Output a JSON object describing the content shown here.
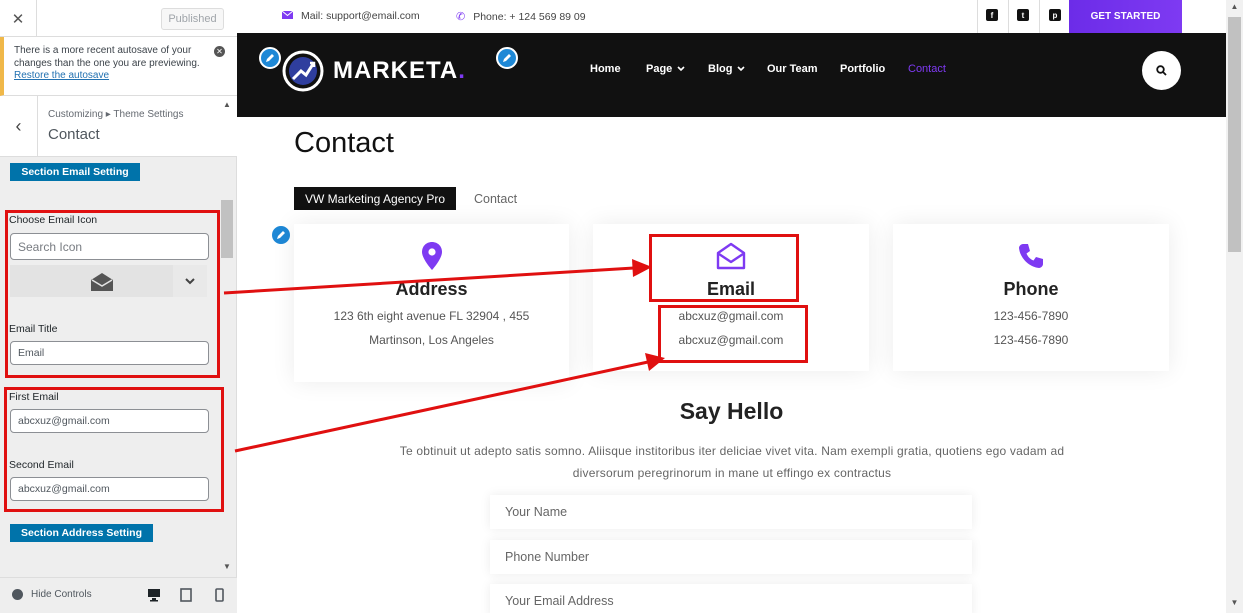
{
  "sidebar": {
    "published_label": "Published",
    "notice": {
      "text": "There is a more recent autosave of your changes than the one you are previewing.",
      "link": "Restore the autosave"
    },
    "breadcrumb": "Customizing ▸ Theme Settings",
    "title": "Contact",
    "section_email_label": "Section Email Setting",
    "choose_icon_label": "Choose Email Icon",
    "search_icon_placeholder": "Search Icon",
    "email_title_label": "Email Title",
    "email_title_value": "Email",
    "first_email_label": "First Email",
    "first_email_value": "abcxuz@gmail.com",
    "second_email_label": "Second Email",
    "second_email_value": "abcxuz@gmail.com",
    "section_address_label": "Section Address Setting",
    "hide_controls_label": "Hide Controls"
  },
  "preview": {
    "topbar": {
      "mail": "Mail: support@email.com",
      "phone": "Phone: + 124 569 89 09",
      "cta": "GET STARTED"
    },
    "logo": "MARKETA",
    "nav": [
      {
        "label": "Home"
      },
      {
        "label": "Page"
      },
      {
        "label": "Blog"
      },
      {
        "label": "Our Team"
      },
      {
        "label": "Portfolio"
      },
      {
        "label": "Contact"
      }
    ],
    "page_title": "Contact",
    "breadcrumb_home": "VW Marketing Agency Pro",
    "breadcrumb_current": "Contact",
    "cards": {
      "address": {
        "title": "Address",
        "line1": "123 6th eight avenue FL 32904 , 455",
        "line2": "Martinson, Los Angeles"
      },
      "email": {
        "title": "Email",
        "line1": "abcxuz@gmail.com",
        "line2": "abcxuz@gmail.com"
      },
      "phone": {
        "title": "Phone",
        "line1": "123-456-7890",
        "line2": "123-456-7890"
      }
    },
    "say_hello": "Say Hello",
    "lorem": "Te obtinuit ut adepto satis somno. Aliisque institoribus iter deliciae vivet vita. Nam exempli gratia, quotiens ego vadam ad diversorum peregrinorum in mane ut effingo ex contractus",
    "form": {
      "name_placeholder": "Your Name",
      "phone_placeholder": "Phone Number",
      "email_placeholder": "Your Email Address"
    }
  },
  "colors": {
    "accent": "#7e3af2",
    "wp_blue": "#0073aa",
    "highlight_red": "#e01010"
  }
}
